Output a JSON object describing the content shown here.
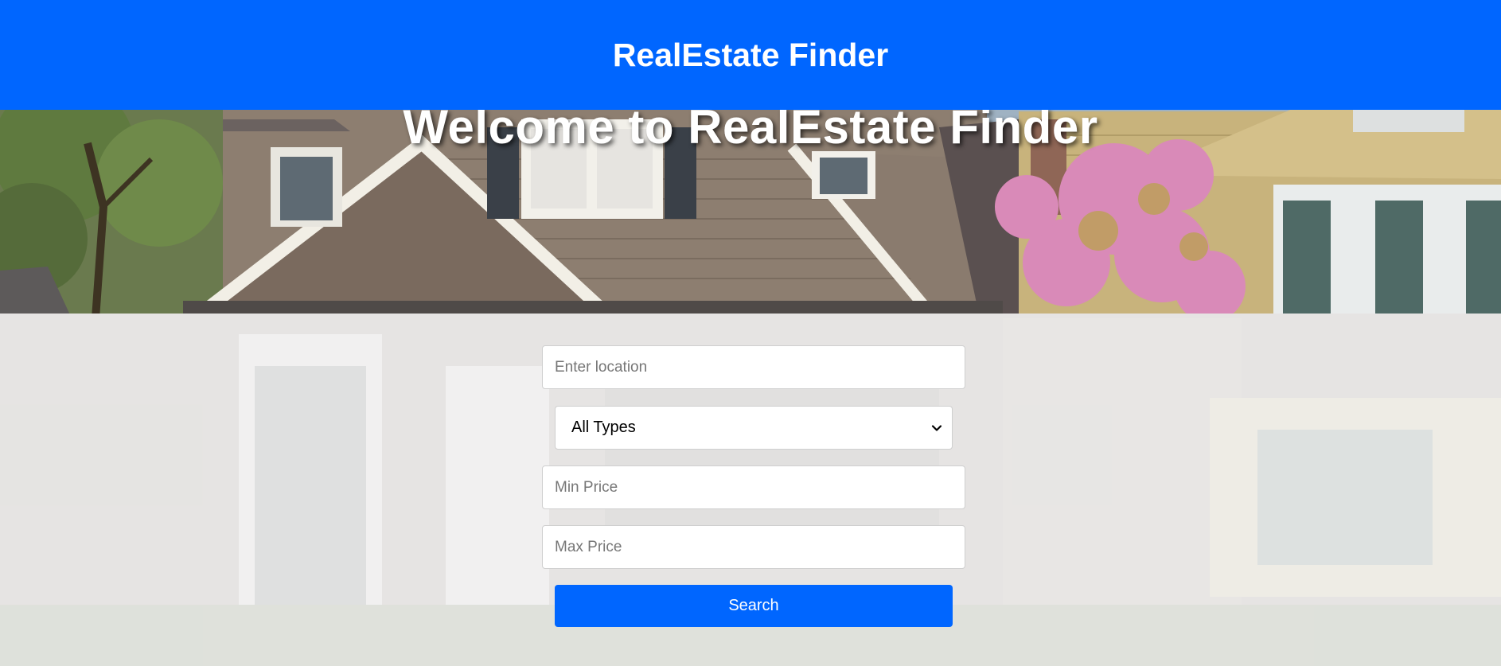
{
  "header": {
    "title": "RealEstate Finder"
  },
  "hero": {
    "heading": "Welcome to RealEstate Finder"
  },
  "search": {
    "location_placeholder": "Enter location",
    "property_type": {
      "selected": "All Types"
    },
    "min_price_placeholder": "Min Price",
    "max_price_placeholder": "Max Price",
    "submit_label": "Search"
  },
  "icons": {
    "select_arrow": "chevron-down-icon"
  },
  "colors": {
    "brand": "#0066ff",
    "header_text": "#ffffff",
    "button_text": "#ffffff",
    "page_background": "#f1f1f1"
  }
}
